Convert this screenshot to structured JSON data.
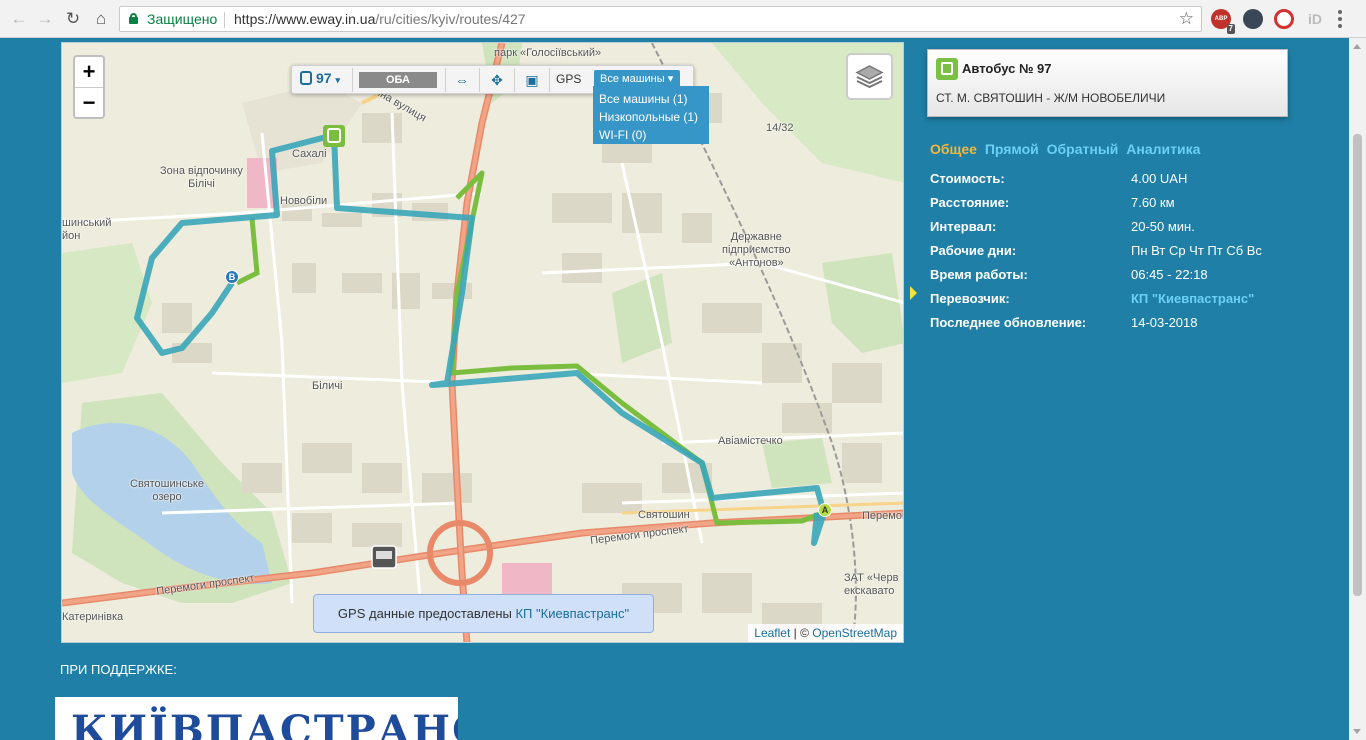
{
  "browser": {
    "secure_label": "Защищено",
    "url_domain": "https://www.eway.in.ua",
    "url_path": "/ru/cities/kyiv/routes/427",
    "ext_badge": "ABP",
    "ext_count": "7",
    "ext_last": "iD"
  },
  "map": {
    "zoom_in": "+",
    "zoom_out": "−",
    "toolbar": {
      "route": "97",
      "direction": "ОБА",
      "gps": "GPS",
      "vehicles": "Все машины ▾"
    },
    "dropdown": [
      "Все машины (1)",
      "Низкопольные (1)",
      "WI-FI (0)"
    ],
    "labels": {
      "park": "парк «Голосіївський»",
      "street1": "чна вулиця",
      "zone": "Зона відпочинку\nБілічі",
      "sakhal": "Сахалі",
      "novobili": "Новобіли",
      "district": "шинський\nйон",
      "num": "14/32",
      "antonov": "Державне\nпідприємство\n«Антонов»",
      "bilichi": "Біличі",
      "aviamistechko": "Авіамістечко",
      "lake": "Святошинське\nозеро",
      "sviatoshyn": "Святошин",
      "prospekt1": "Перемоги проспект",
      "prospekt2": "Перемоги проспект",
      "peremoh_right": "Перемог",
      "katerynivka": "Катеринівка",
      "zat": "ЗАТ «Черв\nекскавато"
    },
    "markers": {
      "a": "A",
      "b": "B"
    },
    "gps_note_prefix": "GPS данные предоставлены ",
    "gps_note_link": "КП \"Киевпастранс\"",
    "attribution_leaflet": "Leaflet",
    "attribution_sep": " | © ",
    "attribution_osm": "OpenStreetMap"
  },
  "route_card": {
    "title": "Автобус № 97",
    "subtitle": "СТ. М. СВЯТОШИН - Ж/М НОВОБЕЛИЧИ"
  },
  "tabs": [
    "Общее",
    "Прямой",
    "Обратный",
    "Аналитика"
  ],
  "info": [
    {
      "key": "Стоимость:",
      "value": "4.00 UAH"
    },
    {
      "key": "Расстояние:",
      "value": "7.60 км"
    },
    {
      "key": "Интервал:",
      "value": "20-50 мин."
    },
    {
      "key": "Рабочие дни:",
      "value": "Пн Вт Ср Чт Пт Сб Вс"
    },
    {
      "key": "Время работы:",
      "value": "06:45 - 22:18"
    },
    {
      "key": "Перевозчик:",
      "value": "КП \"Киевпастранс\""
    },
    {
      "key": "Последнее обновление:",
      "value": "14-03-2018"
    }
  ],
  "support_label": "ПРИ ПОДДЕРЖКЕ:",
  "logo_text": "КИЇВПАСТРАНС",
  "colors": {
    "page_bg": "#1f7fa6",
    "route_forward": "#7bbd3f",
    "route_back": "#3aa6b8",
    "road_main": "#e8896a",
    "accent_tab": "#f5b73a",
    "link": "#6ad0f5"
  }
}
